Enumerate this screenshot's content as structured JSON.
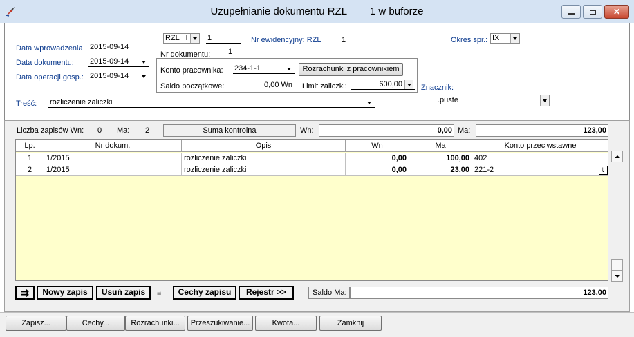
{
  "window": {
    "title": "Uzupełnianie dokumentu RZL        1 w buforze"
  },
  "header": {
    "data_wprowadzenia_label": "Data wprowadzenia",
    "data_wprowadzenia_value": "2015-09-14",
    "data_dokumentu_label": "Data dokumentu:",
    "data_dokumentu_value": "2015-09-14",
    "data_operacji_label": "Data operacji gosp.:",
    "data_operacji_value": "2015-09-14",
    "tresc_label": "Treść:",
    "tresc_value": "rozliczenie zaliczki",
    "doc_type_value": "RZL",
    "doc_type_suffix": "I",
    "doc_number": "1",
    "nr_ewid_label": "Nr ewidencyjny: RZL",
    "nr_ewid_value": "1",
    "nr_dokumentu_label": "Nr dokumentu:",
    "nr_dokumentu_value": "1",
    "okres_label": "Okres spr.:",
    "okres_value": "IX",
    "konto_label": "Konto pracownika:",
    "konto_value": "234-1-1",
    "rozrachunki_button": "Rozrachunki z pracownikiem",
    "saldo_label": "Saldo początkowe:",
    "saldo_value": "0,00 Wn",
    "limit_label": "Limit zaliczki:",
    "limit_value": "600,00",
    "znacznik_label": "Znacznik:",
    "znacznik_value": ".puste"
  },
  "summary": {
    "liczba_label": "Liczba zapisów Wn:",
    "liczba_wn": "0",
    "ma_label": "Ma:",
    "liczba_ma": "2",
    "suma_label": "Suma kontrolna",
    "wn_label": "Wn:",
    "suma_wn": "0,00",
    "ma_label2": "Ma:",
    "suma_ma": "123,00"
  },
  "table": {
    "columns": [
      "Lp.",
      "Nr dokum.",
      "Opis",
      "Wn",
      "Ma",
      "Konto przeciwstawne"
    ],
    "rows": [
      {
        "lp": "1",
        "nr": "1/2015",
        "opis": "rozliczenie zaliczki",
        "wn": "0,00",
        "ma": "100,00",
        "konto": "402"
      },
      {
        "lp": "2",
        "nr": "1/2015",
        "opis": "rozliczenie zaliczki",
        "wn": "0,00",
        "ma": "23,00",
        "konto": "221-2"
      }
    ]
  },
  "toolbar": {
    "nowy_zapis": "Nowy zapis",
    "usun_zapis": "Usuń zapis",
    "cechy_zapisu": "Cechy zapisu",
    "rejestr": "Rejestr >>",
    "saldo_ma_label": "Saldo Ma:",
    "saldo_ma_value": "123,00"
  },
  "bottom_buttons": {
    "zapisz": "Zapisz...",
    "cechy": "Cechy...",
    "rozrachunki": "Rozrachunki...",
    "przeszukiwanie": "Przeszukiwanie...",
    "kwota": "Kwota...",
    "zamknij": "Zamknij"
  },
  "colors": {
    "grid_background": "#ffffcc",
    "titlebar": "#d5e3f3",
    "close_button": "#c8472f"
  }
}
